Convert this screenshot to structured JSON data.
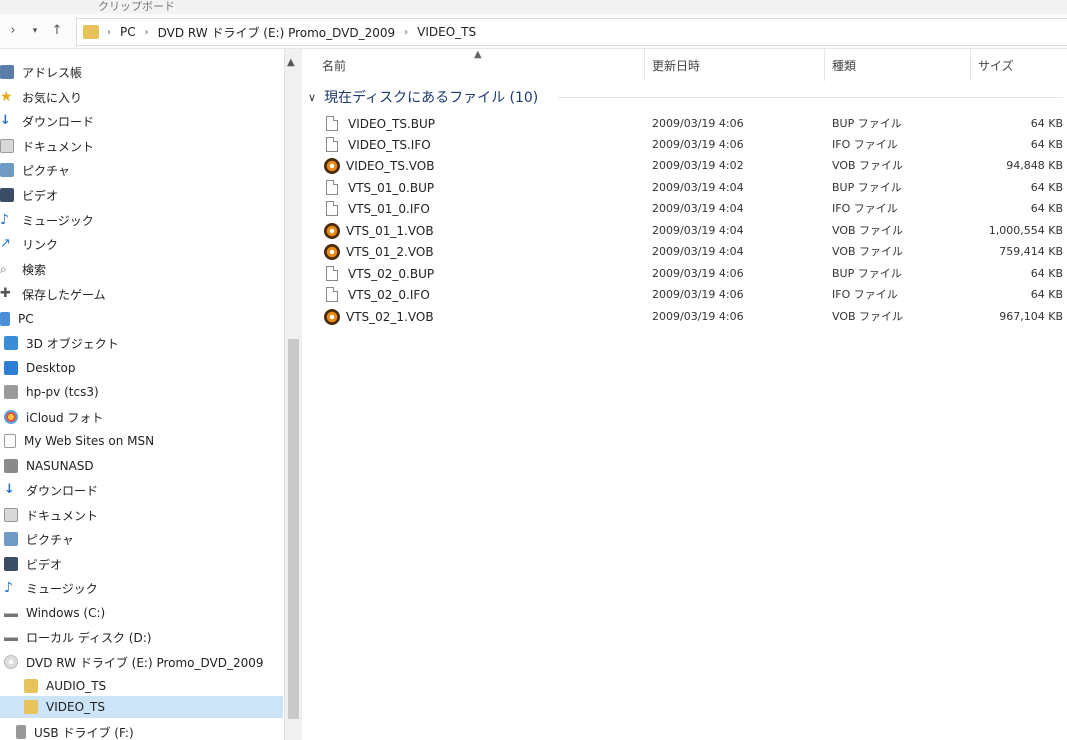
{
  "ribbon": {
    "label": "クリップボード"
  },
  "address": {
    "crumbs": [
      "PC",
      "DVD RW ドライブ (E:) Promo_DVD_2009",
      "VIDEO_TS"
    ]
  },
  "sidebar": {
    "items": [
      {
        "label": "アドレス帳"
      },
      {
        "label": "お気に入り"
      },
      {
        "label": "ダウンロード"
      },
      {
        "label": "ドキュメント"
      },
      {
        "label": "ピクチャ"
      },
      {
        "label": "ビデオ"
      },
      {
        "label": "ミュージック"
      },
      {
        "label": "リンク"
      },
      {
        "label": "検索"
      },
      {
        "label": "保存したゲーム"
      },
      {
        "label": "PC"
      },
      {
        "label": "3D オブジェクト"
      },
      {
        "label": "Desktop"
      },
      {
        "label": "hp-pv (tcs3)"
      },
      {
        "label": "iCloud フォト"
      },
      {
        "label": "My Web Sites on MSN"
      },
      {
        "label": "NASUNASD"
      },
      {
        "label": "ダウンロード"
      },
      {
        "label": "ドキュメント"
      },
      {
        "label": "ピクチャ"
      },
      {
        "label": "ビデオ"
      },
      {
        "label": "ミュージック"
      },
      {
        "label": "Windows (C:)"
      },
      {
        "label": "ローカル ディスク (D:)"
      },
      {
        "label": "DVD RW ドライブ (E:) Promo_DVD_2009"
      },
      {
        "label": "AUDIO_TS"
      },
      {
        "label": "VIDEO_TS"
      },
      {
        "label": "USB ドライブ (F:)"
      }
    ]
  },
  "columns": {
    "name": "名前",
    "date": "更新日時",
    "type": "種類",
    "size": "サイズ"
  },
  "group": {
    "label": "現在ディスクにあるファイル (10)"
  },
  "files": [
    {
      "name": "VIDEO_TS.BUP",
      "date": "2009/03/19 4:06",
      "type": "BUP ファイル",
      "size": "64 KB",
      "icon": "file-icon"
    },
    {
      "name": "VIDEO_TS.IFO",
      "date": "2009/03/19 4:06",
      "type": "IFO ファイル",
      "size": "64 KB",
      "icon": "file-icon"
    },
    {
      "name": "VIDEO_TS.VOB",
      "date": "2009/03/19 4:02",
      "type": "VOB ファイル",
      "size": "94,848 KB",
      "icon": "vob-icon"
    },
    {
      "name": "VTS_01_0.BUP",
      "date": "2009/03/19 4:04",
      "type": "BUP ファイル",
      "size": "64 KB",
      "icon": "file-icon"
    },
    {
      "name": "VTS_01_0.IFO",
      "date": "2009/03/19 4:04",
      "type": "IFO ファイル",
      "size": "64 KB",
      "icon": "file-icon"
    },
    {
      "name": "VTS_01_1.VOB",
      "date": "2009/03/19 4:04",
      "type": "VOB ファイル",
      "size": "1,000,554 KB",
      "icon": "vob-icon"
    },
    {
      "name": "VTS_01_2.VOB",
      "date": "2009/03/19 4:04",
      "type": "VOB ファイル",
      "size": "759,414 KB",
      "icon": "vob-icon"
    },
    {
      "name": "VTS_02_0.BUP",
      "date": "2009/03/19 4:06",
      "type": "BUP ファイル",
      "size": "64 KB",
      "icon": "file-icon"
    },
    {
      "name": "VTS_02_0.IFO",
      "date": "2009/03/19 4:06",
      "type": "IFO ファイル",
      "size": "64 KB",
      "icon": "file-icon"
    },
    {
      "name": "VTS_02_1.VOB",
      "date": "2009/03/19 4:06",
      "type": "VOB ファイル",
      "size": "967,104 KB",
      "icon": "vob-icon"
    }
  ],
  "colors": {
    "selected": "#cce4f7",
    "group_text": "#1e3a6e",
    "folder": "#e8c35c"
  }
}
